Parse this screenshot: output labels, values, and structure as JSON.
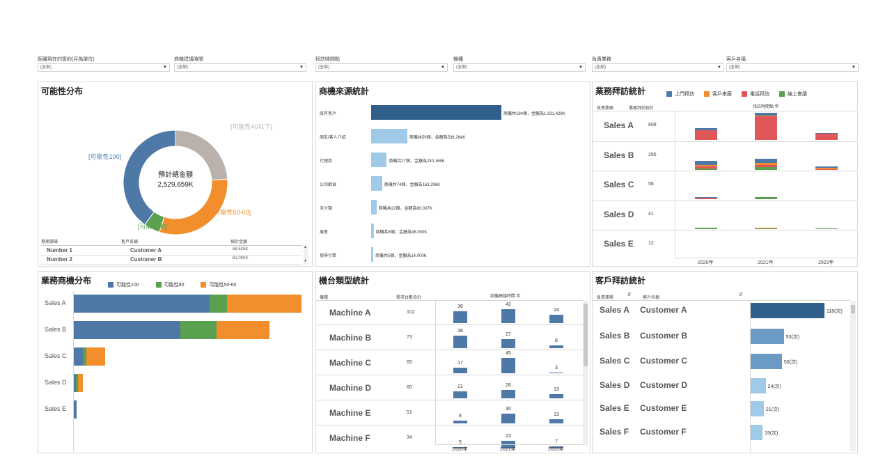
{
  "filters": [
    {
      "label": "距離現在的簽約(月為單位)",
      "value": "(全部)"
    },
    {
      "label": "商機建議時間",
      "value": "(全部)"
    },
    {
      "label": "拜訪時間點",
      "value": "(全部)"
    },
    {
      "label": "機種",
      "value": "(全部)"
    },
    {
      "label": "負責業務",
      "value": "(全部)"
    },
    {
      "label": "客戶名稱",
      "value": "(全部)"
    }
  ],
  "colors": {
    "dark_blue": "#2f5f8a",
    "blue": "#4e79a7",
    "light_blue": "#a0cbe8",
    "mid_blue": "#6b9ac4",
    "orange": "#f28e2b",
    "green": "#59a14f",
    "red": "#e15759",
    "gray": "#bab0ac"
  },
  "donut": {
    "title": "可能性分布",
    "center_label": "預計總金額",
    "center_value": "2,529,659K",
    "slices": [
      {
        "label": "[可能性40以下]",
        "value": 24,
        "color": "#bab0ac"
      },
      {
        "label": "[可能性50-60]",
        "value": 31,
        "color": "#f28e2b"
      },
      {
        "label": "[可能性80]",
        "value": 5,
        "color": "#59a14f"
      },
      {
        "label": "[可能性100]",
        "value": 40,
        "color": "#4e79a7"
      }
    ],
    "table": {
      "headers": [
        "專案號碼",
        "客戶名稱",
        "預計金額"
      ],
      "rows": [
        [
          "Number 1",
          "Customer A",
          "68,625K"
        ],
        [
          "Number 2",
          "Customer B",
          "61,000K"
        ]
      ]
    }
  },
  "source": {
    "title": "商機來源統計",
    "rows": [
      {
        "cat": "既有客戶",
        "count": 184,
        "amount": 1931429,
        "text": "商機共184個，金額為1,931,429K",
        "color": "#2f5f8a"
      },
      {
        "cat": "朋友/客人介紹",
        "count": 59,
        "amount": 536264,
        "text": "商機共59個，金額為536,264K",
        "color": "#a0cbe8"
      },
      {
        "cat": "代理商",
        "count": 27,
        "amount": 230165,
        "text": "商機共27個，金額為230,165K",
        "color": "#a0cbe8"
      },
      {
        "cat": "公司網頁",
        "count": 74,
        "amount": 163206,
        "text": "商機共74個，金額為163,206K",
        "color": "#a0cbe8"
      },
      {
        "cat": "未分類",
        "count": 22,
        "amount": 80007,
        "text": "商機共22個，金額為80,007K",
        "color": "#a0cbe8"
      },
      {
        "cat": "展會",
        "count": 6,
        "amount": 38000,
        "text": "商機共6個，金額為38,000K",
        "color": "#a0cbe8"
      },
      {
        "cat": "搜尋引擎",
        "count": 5,
        "amount": 14000,
        "text": "商機共5個，金額為14,000K",
        "color": "#a0cbe8"
      }
    ]
  },
  "visits": {
    "title": "業務拜訪統計",
    "legend": [
      {
        "label": "上門拜訪",
        "color": "#4e79a7"
      },
      {
        "label": "客戶來廠",
        "color": "#f28e2b"
      },
      {
        "label": "電話拜訪",
        "color": "#e15759"
      },
      {
        "label": "線上會議",
        "color": "#59a14f"
      }
    ],
    "col_headers": [
      "負責業務",
      "業務拜訪統計",
      "拜訪時間點 年"
    ],
    "years": [
      "2020年",
      "2021年",
      "2022年"
    ],
    "rows": [
      {
        "name": "Sales A",
        "total": "608",
        "stacks": [
          [
            3,
            0,
            14,
            0
          ],
          [
            4,
            1,
            33,
            0
          ],
          [
            1,
            0,
            9,
            0
          ]
        ]
      },
      {
        "name": "Sales B",
        "total": "295",
        "stacks": [
          [
            5,
            2,
            3,
            2
          ],
          [
            5,
            3,
            3,
            4
          ],
          [
            2,
            2,
            1,
            0
          ]
        ]
      },
      {
        "name": "Sales C",
        "total": "58",
        "stacks": [
          [
            1,
            0,
            2,
            0
          ],
          [
            0,
            0,
            0,
            3
          ],
          [
            0,
            0,
            0,
            0
          ]
        ]
      },
      {
        "name": "Sales D",
        "total": "41",
        "stacks": [
          [
            0,
            0,
            0,
            2
          ],
          [
            0,
            1,
            0,
            1
          ],
          [
            0,
            0,
            0,
            1
          ]
        ]
      },
      {
        "name": "Sales E",
        "total": "12",
        "stacks": [
          [
            0,
            0,
            0,
            0
          ],
          [
            1,
            0,
            0,
            0
          ],
          [
            0,
            0,
            0,
            0
          ]
        ]
      }
    ]
  },
  "biz": {
    "title": "業務商機分布",
    "legend": [
      {
        "label": "可能性100",
        "color": "#4e79a7"
      },
      {
        "label": "可能性80",
        "color": "#59a14f"
      },
      {
        "label": "可能性50-60",
        "color": "#f28e2b"
      }
    ],
    "rows": [
      {
        "name": "Sales A",
        "values": [
          195,
          25,
          107
        ]
      },
      {
        "name": "Sales B",
        "values": [
          153,
          52,
          76
        ]
      },
      {
        "name": "Sales C",
        "values": [
          13,
          5,
          27
        ]
      },
      {
        "name": "Sales D",
        "values": [
          3,
          3,
          7
        ]
      },
      {
        "name": "Sales E",
        "values": [
          4,
          0,
          0
        ]
      }
    ]
  },
  "machine": {
    "title": "機台類型統計",
    "col_headers": [
      "機種",
      "需求台數合計",
      "商機建議時間 年"
    ],
    "years": [
      "2020年",
      "2021年",
      "2022年"
    ],
    "rows": [
      {
        "name": "Machine A",
        "total": "102",
        "values": [
          36,
          42,
          24
        ]
      },
      {
        "name": "Machine B",
        "total": "73",
        "values": [
          38,
          27,
          8
        ]
      },
      {
        "name": "Machine C",
        "total": "65",
        "values": [
          17,
          45,
          3
        ]
      },
      {
        "name": "Machine D",
        "total": "60",
        "values": [
          21,
          26,
          13
        ]
      },
      {
        "name": "Machine E",
        "total": "51",
        "values": [
          8,
          30,
          13
        ]
      },
      {
        "name": "Machine F",
        "total": "34",
        "values": [
          5,
          22,
          7
        ]
      }
    ]
  },
  "customer": {
    "title": "客戶拜訪統計",
    "col_headers": [
      "負責業務",
      "客戶名稱"
    ],
    "rows": [
      {
        "sales": "Sales A",
        "customer": "Customer A",
        "value": 118,
        "text": "118(次)"
      },
      {
        "sales": "Sales B",
        "customer": "Customer B",
        "value": 53,
        "text": "53(次)"
      },
      {
        "sales": "Sales C",
        "customer": "Customer C",
        "value": 50,
        "text": "50(次)"
      },
      {
        "sales": "Sales D",
        "customer": "Customer D",
        "value": 24,
        "text": "24(次)"
      },
      {
        "sales": "Sales E",
        "customer": "Customer E",
        "value": 21,
        "text": "21(次)"
      },
      {
        "sales": "Sales F",
        "customer": "Customer F",
        "value": 19,
        "text": "19(次)"
      }
    ]
  },
  "chart_data": [
    {
      "type": "pie",
      "title": "可能性分布",
      "labels": [
        "[可能性40以下]",
        "[可能性50-60]",
        "[可能性80]",
        "[可能性100]"
      ],
      "values": [
        24,
        31,
        5,
        40
      ]
    },
    {
      "type": "bar",
      "title": "商機來源統計",
      "categories": [
        "既有客戶",
        "朋友/客人介紹",
        "代理商",
        "公司網頁",
        "未分類",
        "展會",
        "搜尋引擎"
      ],
      "values": [
        1931429,
        536264,
        230165,
        163206,
        80007,
        38000,
        14000
      ]
    },
    {
      "type": "bar",
      "title": "業務拜訪統計",
      "categories": [
        "Sales A",
        "Sales B",
        "Sales C",
        "Sales D",
        "Sales E"
      ],
      "values": [
        608,
        295,
        58,
        41,
        12
      ]
    },
    {
      "type": "bar",
      "title": "業務商機分布",
      "categories": [
        "Sales A",
        "Sales B",
        "Sales C",
        "Sales D",
        "Sales E"
      ],
      "series": [
        {
          "name": "可能性100",
          "values": [
            195,
            153,
            13,
            3,
            4
          ]
        },
        {
          "name": "可能性80",
          "values": [
            25,
            52,
            5,
            3,
            0
          ]
        },
        {
          "name": "可能性50-60",
          "values": [
            107,
            76,
            27,
            7,
            0
          ]
        }
      ]
    },
    {
      "type": "bar",
      "title": "機台類型統計",
      "categories": [
        "Machine A",
        "Machine B",
        "Machine C",
        "Machine D",
        "Machine E",
        "Machine F"
      ],
      "x": [
        "2020年",
        "2021年",
        "2022年"
      ],
      "series": [
        {
          "name": "Machine A",
          "values": [
            36,
            42,
            24
          ]
        },
        {
          "name": "Machine B",
          "values": [
            38,
            27,
            8
          ]
        },
        {
          "name": "Machine C",
          "values": [
            17,
            45,
            3
          ]
        },
        {
          "name": "Machine D",
          "values": [
            21,
            26,
            13
          ]
        },
        {
          "name": "Machine E",
          "values": [
            8,
            30,
            13
          ]
        },
        {
          "name": "Machine F",
          "values": [
            5,
            22,
            7
          ]
        }
      ]
    },
    {
      "type": "bar",
      "title": "客戶拜訪統計",
      "categories": [
        "Customer A",
        "Customer B",
        "Customer C",
        "Customer D",
        "Customer E",
        "Customer F"
      ],
      "values": [
        118,
        53,
        50,
        24,
        21,
        19
      ]
    }
  ]
}
